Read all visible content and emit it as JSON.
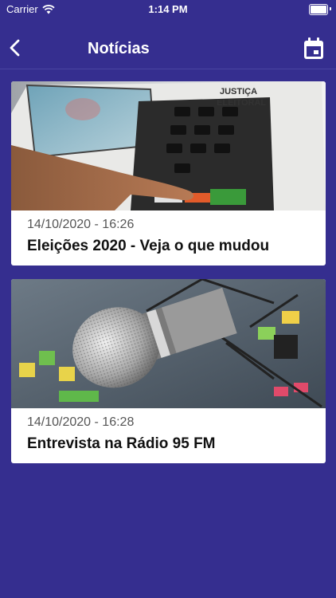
{
  "status_bar": {
    "carrier": "Carrier",
    "time": "1:14 PM"
  },
  "nav": {
    "title": "Notícias",
    "back_icon": "chevron-left-icon",
    "calendar_icon": "calendar-icon"
  },
  "news": [
    {
      "date": "14/10/2020 - 16:26",
      "title": "Eleições 2020 - Veja o que mudou",
      "image": "electronic-voting-machine-photo",
      "image_text": "JUSTIÇA ELEITORAL"
    },
    {
      "date": "14/10/2020 - 16:28",
      "title": "Entrevista na Rádio 95 FM",
      "image": "studio-microphone-photo"
    }
  ],
  "colors": {
    "background": "#352e8f",
    "card": "#ffffff",
    "date_text": "#555555",
    "title_text": "#111111"
  }
}
